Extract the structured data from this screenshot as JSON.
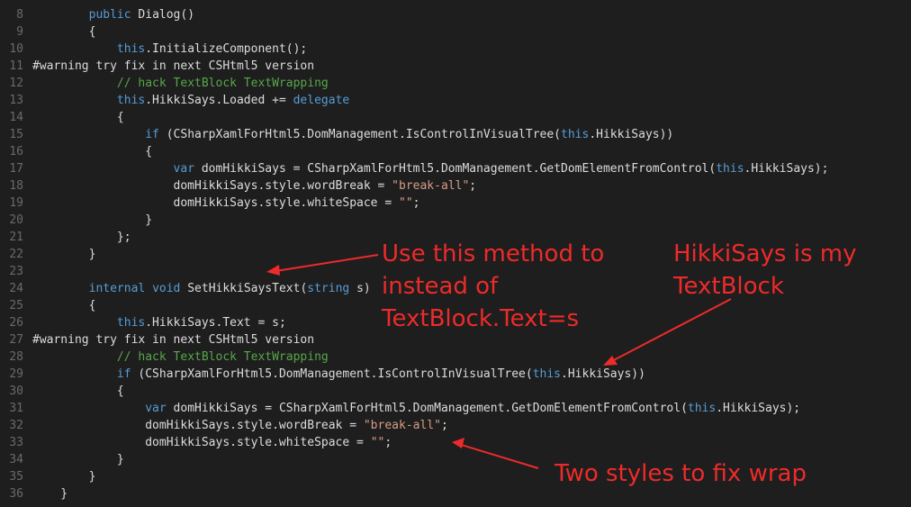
{
  "editor": {
    "colors": {
      "background": "#1e1e1e",
      "text": "#dcdcdc",
      "keyword": "#569cd6",
      "comment": "#57a64a",
      "string": "#d69d85",
      "line_number": "#6a6a6a"
    },
    "lines": [
      {
        "num": "8",
        "tokens": [
          {
            "t": "        "
          },
          {
            "t": "public",
            "c": "kw"
          },
          {
            "t": " Dialog()"
          }
        ]
      },
      {
        "num": "9",
        "tokens": [
          {
            "t": "        {"
          }
        ]
      },
      {
        "num": "10",
        "tokens": [
          {
            "t": "            "
          },
          {
            "t": "this",
            "c": "kw"
          },
          {
            "t": ".InitializeComponent();"
          }
        ]
      },
      {
        "num": "11",
        "tokens": [
          {
            "t": "#warning try fix in next CSHtml5 version"
          }
        ]
      },
      {
        "num": "12",
        "tokens": [
          {
            "t": "            "
          },
          {
            "t": "// hack TextBlock TextWrapping",
            "c": "cm"
          }
        ]
      },
      {
        "num": "13",
        "tokens": [
          {
            "t": "            "
          },
          {
            "t": "this",
            "c": "kw"
          },
          {
            "t": ".HikkiSays.Loaded += "
          },
          {
            "t": "delegate",
            "c": "kw"
          }
        ]
      },
      {
        "num": "14",
        "tokens": [
          {
            "t": "            {"
          }
        ]
      },
      {
        "num": "15",
        "tokens": [
          {
            "t": "                "
          },
          {
            "t": "if",
            "c": "kw"
          },
          {
            "t": " (CSharpXamlForHtml5.DomManagement.IsControlInVisualTree("
          },
          {
            "t": "this",
            "c": "kw"
          },
          {
            "t": ".HikkiSays))"
          }
        ]
      },
      {
        "num": "16",
        "tokens": [
          {
            "t": "                {"
          }
        ]
      },
      {
        "num": "17",
        "tokens": [
          {
            "t": "                    "
          },
          {
            "t": "var",
            "c": "kw"
          },
          {
            "t": " domHikkiSays = CSharpXamlForHtml5.DomManagement.GetDomElementFromControl("
          },
          {
            "t": "this",
            "c": "kw"
          },
          {
            "t": ".HikkiSays);"
          }
        ]
      },
      {
        "num": "18",
        "tokens": [
          {
            "t": "                    domHikkiSays.style.wordBreak = "
          },
          {
            "t": "\"break-all\"",
            "c": "str"
          },
          {
            "t": ";"
          }
        ]
      },
      {
        "num": "19",
        "tokens": [
          {
            "t": "                    domHikkiSays.style.whiteSpace = "
          },
          {
            "t": "\"\"",
            "c": "str"
          },
          {
            "t": ";"
          }
        ]
      },
      {
        "num": "20",
        "tokens": [
          {
            "t": "                }"
          }
        ]
      },
      {
        "num": "21",
        "tokens": [
          {
            "t": "            };"
          }
        ]
      },
      {
        "num": "22",
        "tokens": [
          {
            "t": "        }"
          }
        ]
      },
      {
        "num": "23",
        "tokens": []
      },
      {
        "num": "24",
        "tokens": [
          {
            "t": "        "
          },
          {
            "t": "internal",
            "c": "kw"
          },
          {
            "t": " "
          },
          {
            "t": "void",
            "c": "kw"
          },
          {
            "t": " SetHikkiSaysText("
          },
          {
            "t": "string",
            "c": "kw"
          },
          {
            "t": " s)"
          }
        ]
      },
      {
        "num": "25",
        "tokens": [
          {
            "t": "        {"
          }
        ]
      },
      {
        "num": "26",
        "tokens": [
          {
            "t": "            "
          },
          {
            "t": "this",
            "c": "kw"
          },
          {
            "t": ".HikkiSays.Text = s;"
          }
        ]
      },
      {
        "num": "27",
        "tokens": [
          {
            "t": "#warning try fix in next CSHtml5 version"
          }
        ]
      },
      {
        "num": "28",
        "tokens": [
          {
            "t": "            "
          },
          {
            "t": "// hack TextBlock TextWrapping",
            "c": "cm"
          }
        ]
      },
      {
        "num": "29",
        "tokens": [
          {
            "t": "            "
          },
          {
            "t": "if",
            "c": "kw"
          },
          {
            "t": " (CSharpXamlForHtml5.DomManagement.IsControlInVisualTree("
          },
          {
            "t": "this",
            "c": "kw"
          },
          {
            "t": ".HikkiSays))"
          }
        ]
      },
      {
        "num": "30",
        "tokens": [
          {
            "t": "            {"
          }
        ]
      },
      {
        "num": "31",
        "tokens": [
          {
            "t": "                "
          },
          {
            "t": "var",
            "c": "kw"
          },
          {
            "t": " domHikkiSays = CSharpXamlForHtml5.DomManagement.GetDomElementFromControl("
          },
          {
            "t": "this",
            "c": "kw"
          },
          {
            "t": ".HikkiSays);"
          }
        ]
      },
      {
        "num": "32",
        "tokens": [
          {
            "t": "                domHikkiSays.style.wordBreak = "
          },
          {
            "t": "\"break-all\"",
            "c": "str"
          },
          {
            "t": ";"
          }
        ]
      },
      {
        "num": "33",
        "tokens": [
          {
            "t": "                domHikkiSays.style.whiteSpace = "
          },
          {
            "t": "\"\"",
            "c": "str"
          },
          {
            "t": ";"
          }
        ]
      },
      {
        "num": "34",
        "tokens": [
          {
            "t": "            }"
          }
        ]
      },
      {
        "num": "35",
        "tokens": [
          {
            "t": "        }"
          }
        ]
      },
      {
        "num": "36",
        "tokens": [
          {
            "t": "    }"
          }
        ]
      }
    ]
  },
  "annotations": {
    "color": "#ee2a2a",
    "method_note": "Use this method to\ninstead of\nTextBlock.Text=s",
    "textblock_note": "HikkiSays is my\nTextBlock",
    "styles_note": "Two styles to fix wrap"
  }
}
